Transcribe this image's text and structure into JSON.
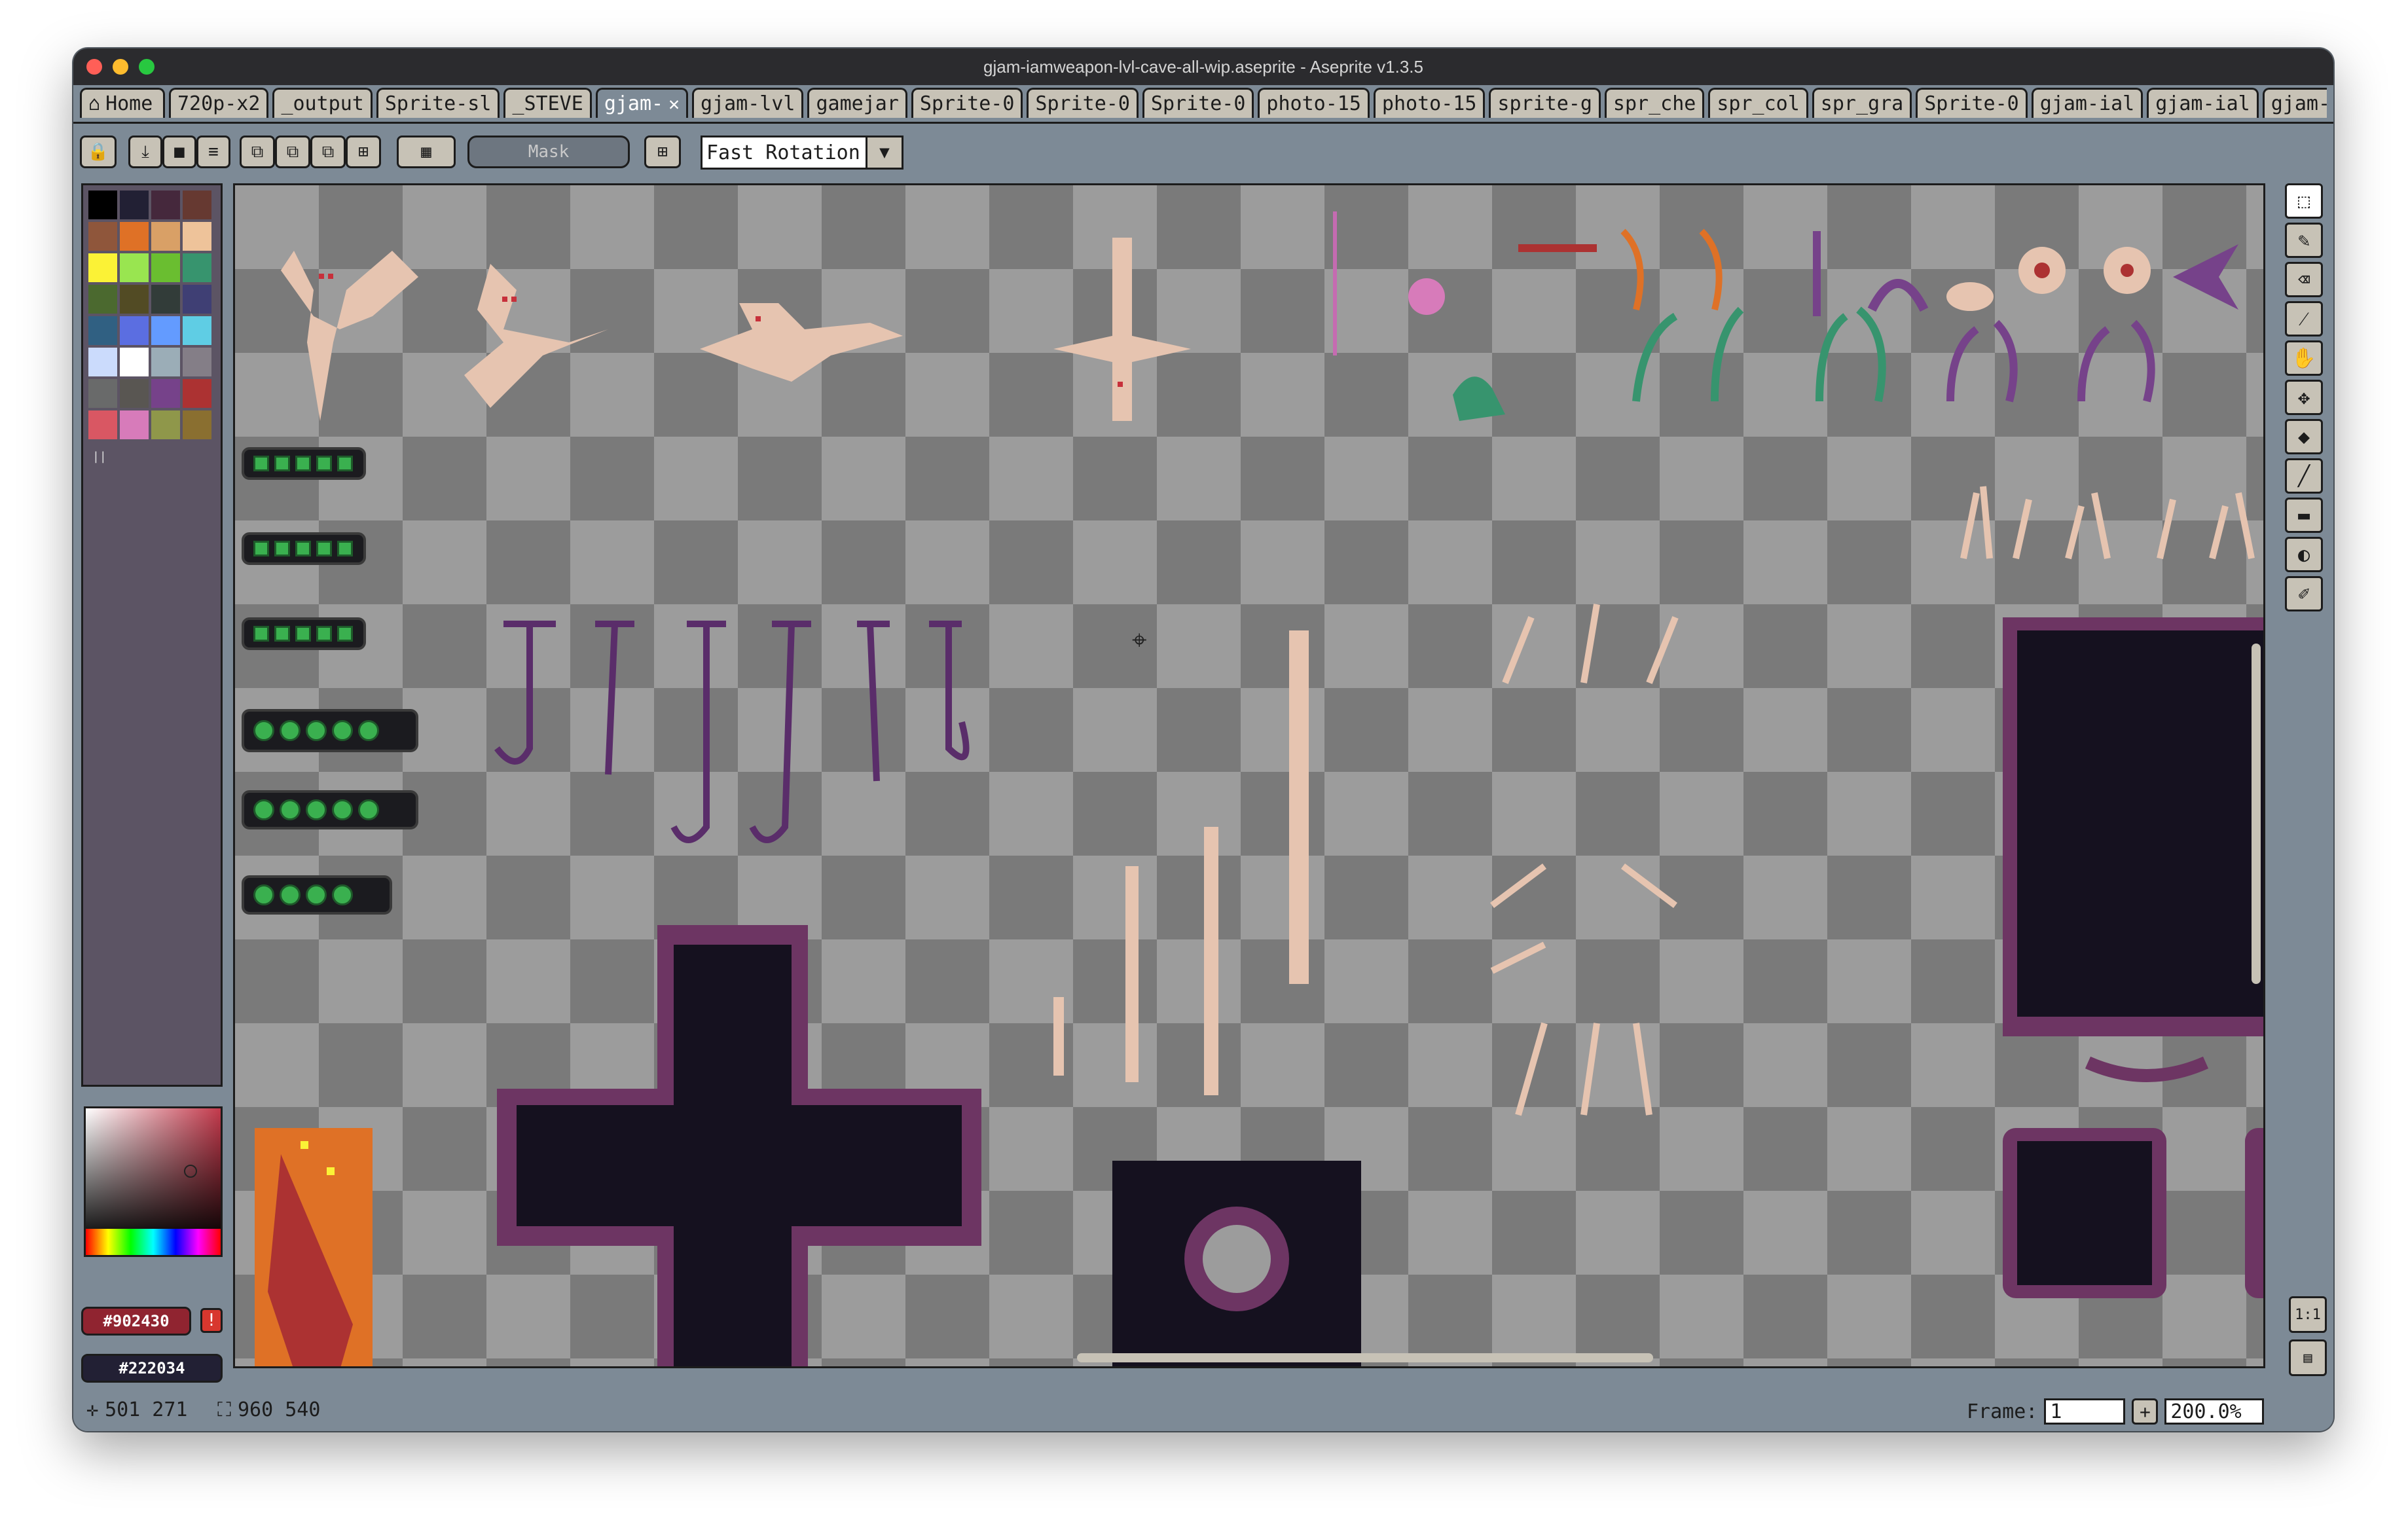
{
  "window": {
    "title": "gjam-iamweapon-lvl-cave-all-wip.aseprite - Aseprite v1.3.5"
  },
  "tabs": [
    {
      "label": "Home",
      "icon": "home-icon"
    },
    {
      "label": "720p-x2"
    },
    {
      "label": "_output"
    },
    {
      "label": "Sprite-sl"
    },
    {
      "label": "_STEVE"
    },
    {
      "label": "gjam-",
      "active": true
    },
    {
      "label": "gjam-lvl"
    },
    {
      "label": "gamejar"
    },
    {
      "label": "Sprite-0"
    },
    {
      "label": "Sprite-0"
    },
    {
      "label": "Sprite-0"
    },
    {
      "label": "photo-15"
    },
    {
      "label": "photo-15"
    },
    {
      "label": "sprite-g"
    },
    {
      "label": "spr_che"
    },
    {
      "label": "spr_col"
    },
    {
      "label": "spr_gra"
    },
    {
      "label": "Sprite-0"
    },
    {
      "label": "gjam-ial"
    },
    {
      "label": "gjam-ial"
    },
    {
      "label": "gjam-ial"
    }
  ],
  "toolbar": {
    "mask_label": "Mask",
    "rotation_algorithm": "Fast Rotation"
  },
  "palette": {
    "colors": [
      "#000000",
      "#222034",
      "#45283c",
      "#663931",
      "#8f563b",
      "#df7126",
      "#d9a066",
      "#eec39a",
      "#fbf236",
      "#99e550",
      "#6abe30",
      "#37946e",
      "#4b692f",
      "#524b24",
      "#323c39",
      "#3f3f74",
      "#306082",
      "#5b6ee1",
      "#639bff",
      "#5fcde4",
      "#cbdbfc",
      "#ffffff",
      "#9badb7",
      "#847e87",
      "#696a6a",
      "#595652",
      "#76428a",
      "#ac3232",
      "#d95763",
      "#d77bba",
      "#8f974a",
      "#8a6f30"
    ]
  },
  "colors": {
    "foreground_hex": "#902430",
    "background_hex": "#222034",
    "foreground": "#902430",
    "background": "#222034",
    "accent": "#c7c2b6"
  },
  "status": {
    "cursor_pos": "501 271",
    "sprite_size": "960 540",
    "frame_label": "Frame:",
    "frame_value": "1",
    "zoom": "200.0%"
  },
  "tools": [
    "rect-marquee-icon",
    "pencil-icon",
    "eraser-icon",
    "eyedropper-icon",
    "hand-icon",
    "move-icon",
    "paint-bucket-icon",
    "line-icon",
    "rectangle-icon",
    "contour-icon",
    "blur-icon"
  ]
}
